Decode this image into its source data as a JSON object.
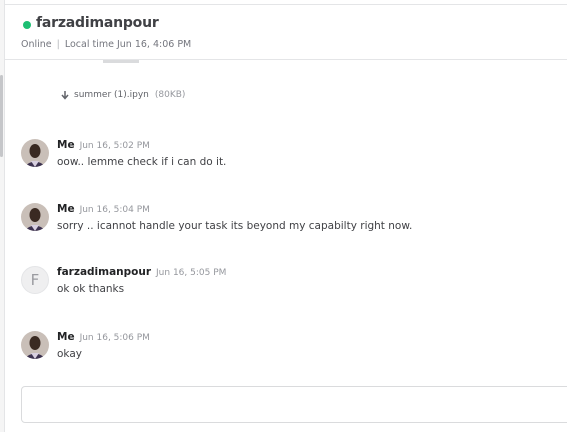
{
  "conversation": {
    "username": "farzadimanpour",
    "status": "Online",
    "local_time": "Local time Jun 16, 4:06 PM",
    "status_color": "#1dbf73"
  },
  "attachment": {
    "icon": "download-arrow-icon",
    "filename": "summer (1).ipyn",
    "size": "(80KB)"
  },
  "messages": [
    {
      "sender": "Me",
      "time": "Jun 16, 5:02 PM",
      "text": "oow.. lemme check if i can do it.",
      "avatar": "photo"
    },
    {
      "sender": "Me",
      "time": "Jun 16, 5:04 PM",
      "text": "sorry .. icannot handle your task its beyond my capabilty right now.",
      "avatar": "photo"
    },
    {
      "sender": "farzadimanpour",
      "time": "Jun 16, 5:05 PM",
      "text": "ok ok thanks",
      "avatar": "initial",
      "initial": "F"
    },
    {
      "sender": "Me",
      "time": "Jun 16, 5:06 PM",
      "text": "okay",
      "avatar": "photo"
    }
  ],
  "composer": {
    "placeholder": ""
  }
}
